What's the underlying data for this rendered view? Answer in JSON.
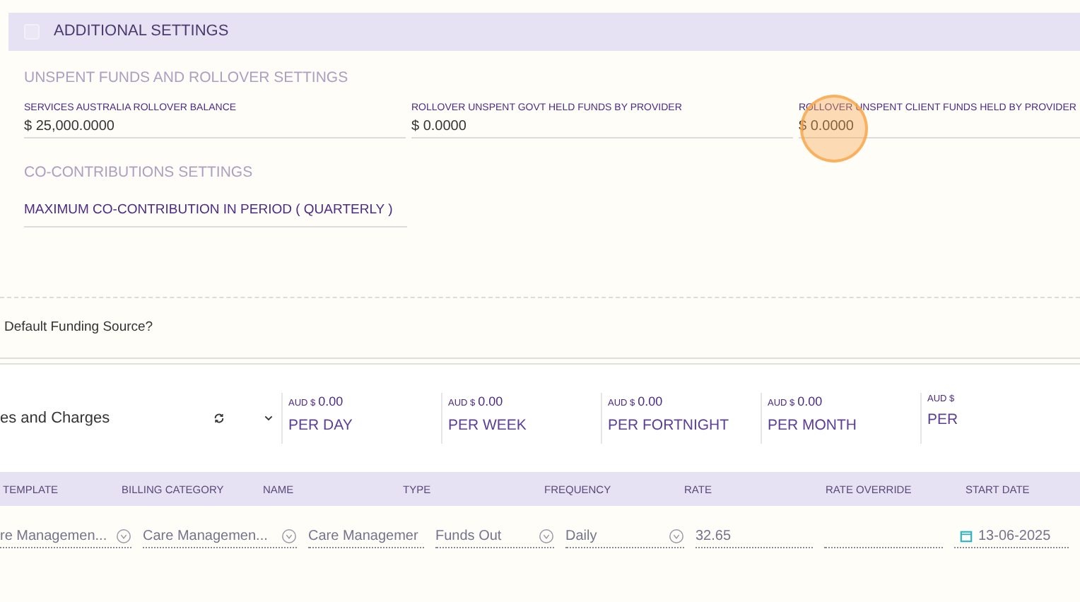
{
  "additional_settings": {
    "title": "ADDITIONAL SETTINGS",
    "checked": false
  },
  "unspent_funds": {
    "title": "UNSPENT FUNDS AND ROLLOVER SETTINGS",
    "fields": [
      {
        "label": "SERVICES AUSTRALIA ROLLOVER BALANCE",
        "value": "$ 25,000.0000"
      },
      {
        "label": "ROLLOVER UNSPENT GOVT HELD FUNDS BY PROVIDER",
        "value": "$ 0.0000"
      },
      {
        "label": "ROLLOVER UNSPENT CLIENT FUNDS HELD BY PROVIDER",
        "value": "$ 0.0000"
      }
    ]
  },
  "co_contributions": {
    "title": "CO-CONTRIBUTIONS SETTINGS",
    "field_label": "MAXIMUM CO-CONTRIBUTION IN PERIOD ( QUARTERLY )"
  },
  "default_funding": {
    "label": "Default Funding Source?"
  },
  "fees": {
    "title": "es and Charges",
    "summary": [
      {
        "prefix": "AUD $",
        "amount": "0.00",
        "period": "PER DAY"
      },
      {
        "prefix": "AUD $",
        "amount": "0.00",
        "period": "PER WEEK"
      },
      {
        "prefix": "AUD $",
        "amount": "0.00",
        "period": "PER FORTNIGHT"
      },
      {
        "prefix": "AUD $",
        "amount": "0.00",
        "period": "PER MONTH"
      },
      {
        "prefix": "AUD $",
        "period": "PER"
      }
    ],
    "columns": [
      "TEMPLATE",
      "BILLING CATEGORY",
      "NAME",
      "TYPE",
      "FREQUENCY",
      "RATE",
      "RATE OVERRIDE",
      "START DATE"
    ],
    "row": [
      {
        "kind": "select",
        "value": "re Managemen..."
      },
      {
        "kind": "select",
        "value": "Care Managemen..."
      },
      {
        "kind": "text",
        "value": "Care Managemer"
      },
      {
        "kind": "select",
        "value": "Funds Out"
      },
      {
        "kind": "select",
        "value": "Daily"
      },
      {
        "kind": "text",
        "value": "32.65"
      },
      {
        "kind": "text"
      },
      {
        "kind": "date",
        "value": "13-06-2025"
      }
    ]
  },
  "cursor_highlight": true
}
